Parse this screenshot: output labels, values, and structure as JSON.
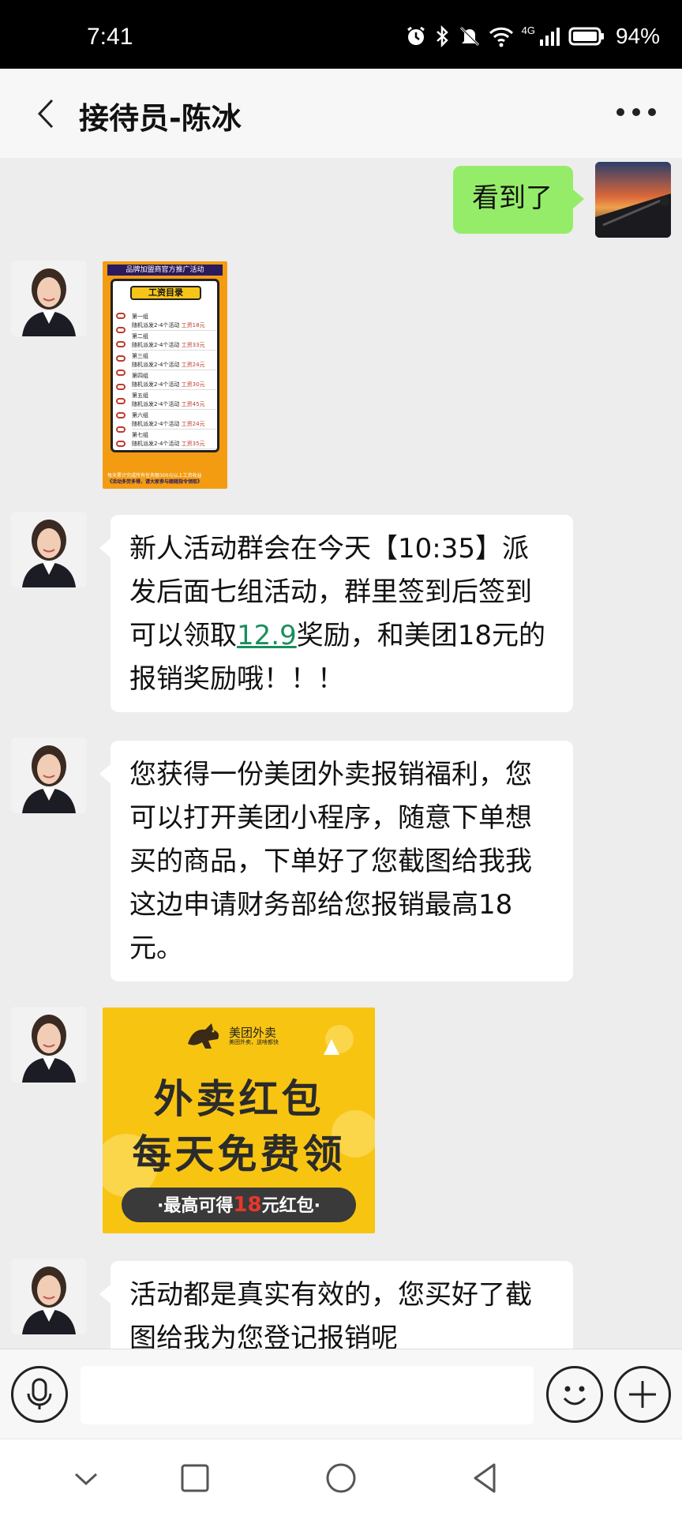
{
  "status_bar": {
    "time": "7:41",
    "network": "4G",
    "battery": "94%",
    "icons": [
      "alarm-icon",
      "bluetooth-icon",
      "mute-icon",
      "wifi-icon",
      "signal-icon",
      "battery-icon"
    ]
  },
  "header": {
    "title": "接待员-陈冰",
    "back_icon": "chevron-left-icon",
    "more_icon": "more-icon"
  },
  "messages": [
    {
      "sender": "me",
      "type": "text",
      "text": "看到了"
    },
    {
      "sender": "them",
      "type": "image",
      "image": "salary-poster"
    },
    {
      "sender": "them",
      "type": "text",
      "text_before": "新人活动群会在今天【10:35】派发后面七组活动，群里签到后签到可以领取",
      "highlight": "12.9",
      "text_after": "奖励，和美团18元的报销奖励哦！！！"
    },
    {
      "sender": "them",
      "type": "text",
      "text": "您获得一份美团外卖报销福利，您可以打开美团小程序，随意下单想买的商品，下单好了您截图给我我这边申请财务部给您报销最高18元。"
    },
    {
      "sender": "them",
      "type": "image",
      "image": "meituan-red-packet"
    },
    {
      "sender": "them",
      "type": "text",
      "text": "活动都是真实有效的，您买好了截图给我为您登记报销呢"
    }
  ],
  "poster": {
    "banner": "品牌加盟商官方推广活动",
    "title": "工资目录",
    "groups": [
      {
        "name": "第一组",
        "task": "随机派发2-4个活动",
        "pay": "工资18元"
      },
      {
        "name": "第二组",
        "task": "随机派发2-4个活动",
        "pay": "工资33元"
      },
      {
        "name": "第三组",
        "task": "随机派发2-4个活动",
        "pay": "工资24元"
      },
      {
        "name": "第四组",
        "task": "随机派发2-4个活动",
        "pay": "工资30元"
      },
      {
        "name": "第五组",
        "task": "随机派发2-4个活动",
        "pay": "工资45元"
      },
      {
        "name": "第六组",
        "task": "随机派发2-4个活动",
        "pay": "工资24元"
      },
      {
        "name": "第七组",
        "task": "随机派发2-4个活动",
        "pay": "工资35元"
      }
    ],
    "footer_1": "每天累计完成所有任务额300元以上工资收益",
    "footer_2": "《活动多劳多得，请大家参与跟随指令领取》"
  },
  "meituan_image": {
    "brand": "美团外卖",
    "brand_sub": "美团外卖，送啥都快",
    "line1": "外卖红包",
    "line2": "每天免费领",
    "pill_before": "·最高可得",
    "pill_amount": "18",
    "pill_after": "元红包·"
  },
  "input_bar": {
    "placeholder": "",
    "icons": [
      "voice-icon",
      "emoji-icon",
      "plus-icon"
    ]
  },
  "nav_bar": {
    "icons": [
      "nav-down-icon",
      "nav-recents-icon",
      "nav-home-icon",
      "nav-back-icon"
    ]
  },
  "colors": {
    "my_bubble": "#95ec69",
    "their_bubble": "#ffffff",
    "chat_background": "#ededed",
    "link": "#1a8f5c"
  }
}
